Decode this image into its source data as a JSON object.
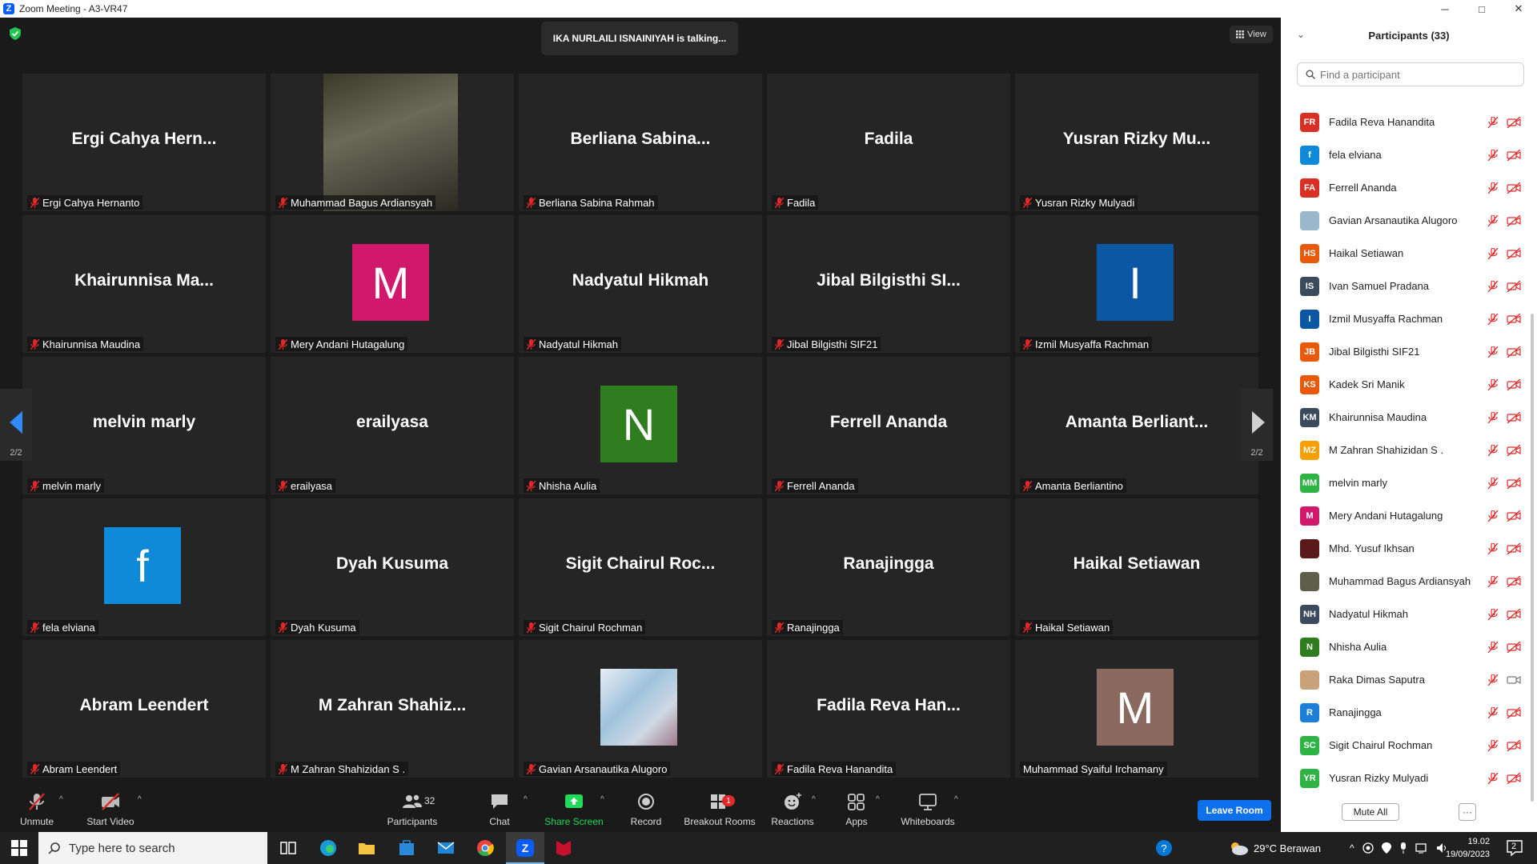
{
  "window": {
    "title": "Zoom Meeting - A3-VR47",
    "minimize": "─",
    "maximize": "□",
    "close": "✕"
  },
  "meeting": {
    "talking_indicator": "IKA NURLAILI ISNAINIYAH is talking...",
    "view_button": "View",
    "page_indicator_left": "2/2",
    "page_indicator_right": "2/2",
    "tiles": [
      {
        "display": "Ergi Cahya Hern...",
        "label": "Ergi Cahya Hernanto",
        "kind": "name",
        "muted": true
      },
      {
        "display": "",
        "label": "Muhammad Bagus Ardiansyah",
        "kind": "photo",
        "muted": true
      },
      {
        "display": "Berliana  Sabina...",
        "label": "Berliana Sabina Rahmah",
        "kind": "name",
        "muted": true
      },
      {
        "display": "Fadila",
        "label": "Fadila",
        "kind": "name",
        "muted": true
      },
      {
        "display": "Yusran  Rizky  Mu...",
        "label": "Yusran Rizky Mulyadi",
        "kind": "name",
        "muted": true
      },
      {
        "display": "Khairunnisa  Ma...",
        "label": "Khairunnisa Maudina",
        "kind": "name",
        "muted": true
      },
      {
        "display": "M",
        "label": "Mery Andani Hutagalung",
        "kind": "avatar",
        "color": "#d0196b",
        "muted": true
      },
      {
        "display": "Nadyatul Hikmah",
        "label": "Nadyatul Hikmah",
        "kind": "name",
        "muted": true
      },
      {
        "display": "Jibal  Bilgisthi  SI...",
        "label": "Jibal Bilgisthi SIF21",
        "kind": "name",
        "muted": true
      },
      {
        "display": "I",
        "label": "Izmil Musyaffa Rachman",
        "kind": "avatar",
        "color": "#0b57a4",
        "muted": true
      },
      {
        "display": "melvin marly",
        "label": "melvin marly",
        "kind": "name",
        "muted": true
      },
      {
        "display": "erailyasa",
        "label": "erailyasa",
        "kind": "name",
        "muted": true
      },
      {
        "display": "N",
        "label": "Nhisha Aulia",
        "kind": "avatar",
        "color": "#2e7d1e",
        "muted": true
      },
      {
        "display": "Ferrell Ananda",
        "label": "Ferrell Ananda",
        "kind": "name",
        "muted": true
      },
      {
        "display": "Amanta  Berliant...",
        "label": "Amanta Berliantino",
        "kind": "name",
        "muted": true
      },
      {
        "display": "f",
        "label": "fela elviana",
        "kind": "avatar",
        "color": "#0e8ad8",
        "muted": true
      },
      {
        "display": "Dyah Kusuma",
        "label": "Dyah Kusuma",
        "kind": "name",
        "muted": true
      },
      {
        "display": "Sigit  Chairul  Roc...",
        "label": "Sigit Chairul Rochman",
        "kind": "name",
        "muted": true
      },
      {
        "display": "Ranajingga",
        "label": "Ranajingga",
        "kind": "name",
        "muted": true
      },
      {
        "display": "Haikal Setiawan",
        "label": "Haikal Setiawan",
        "kind": "name",
        "muted": true
      },
      {
        "display": "Abram Leendert",
        "label": "Abram Leendert",
        "kind": "name",
        "muted": true
      },
      {
        "display": "M  Zahran  Shahiz...",
        "label": "M Zahran Shahizidan S .",
        "kind": "name",
        "muted": true
      },
      {
        "display": "",
        "label": "Gavian Arsanautika Alugoro",
        "kind": "photo2",
        "muted": true
      },
      {
        "display": "Fadila  Reva  Han...",
        "label": "Fadila Reva Hanandita",
        "kind": "name",
        "muted": true
      },
      {
        "display": "M",
        "label": "Muhammad Syaiful Irchamany",
        "kind": "avatar",
        "color": "#8a6a5e",
        "muted": false
      }
    ]
  },
  "toolbar": {
    "unmute": "Unmute",
    "start_video": "Start Video",
    "participants": "Participants",
    "participants_count": "32",
    "chat": "Chat",
    "share_screen": "Share Screen",
    "record": "Record",
    "breakout_rooms": "Breakout Rooms",
    "breakout_badge": "1",
    "reactions": "Reactions",
    "apps": "Apps",
    "whiteboards": "Whiteboards",
    "leave": "Leave Room"
  },
  "panel": {
    "title": "Participants (33)",
    "search_placeholder": "Find a participant",
    "mute_all": "Mute All",
    "more": "···",
    "participants": [
      {
        "initials": "FR",
        "name": "Fadila Reva Hanandita",
        "color": "#d93025",
        "video": "off"
      },
      {
        "initials": "f",
        "name": "fela elviana",
        "color": "#0e8ad8",
        "video": "off"
      },
      {
        "initials": "FA",
        "name": "Ferrell Ananda",
        "color": "#d93025",
        "video": "off"
      },
      {
        "initials": "",
        "name": "Gavian Arsanautika Alugoro",
        "color": "#9bb7cc",
        "video": "off"
      },
      {
        "initials": "HS",
        "name": "Haikal Setiawan",
        "color": "#e8590c",
        "video": "off"
      },
      {
        "initials": "IS",
        "name": "Ivan Samuel Pradana",
        "color": "#3c4a5e",
        "video": "off"
      },
      {
        "initials": "I",
        "name": "Izmil Musyaffa Rachman",
        "color": "#0b57a4",
        "video": "off"
      },
      {
        "initials": "JB",
        "name": "Jibal Bilgisthi SIF21",
        "color": "#e8590c",
        "video": "off"
      },
      {
        "initials": "KS",
        "name": "Kadek Sri Manik",
        "color": "#e8590c",
        "video": "off"
      },
      {
        "initials": "KM",
        "name": "Khairunnisa Maudina",
        "color": "#3c4a5e",
        "video": "off"
      },
      {
        "initials": "MZ",
        "name": "M Zahran Shahizidan S .",
        "color": "#f59f00",
        "video": "off"
      },
      {
        "initials": "MM",
        "name": "melvin marly",
        "color": "#2fb344",
        "video": "off"
      },
      {
        "initials": "M",
        "name": "Mery Andani Hutagalung",
        "color": "#d0196b",
        "video": "off"
      },
      {
        "initials": "",
        "name": "Mhd. Yusuf Ikhsan",
        "color": "#5a1a1a",
        "video": "off"
      },
      {
        "initials": "",
        "name": "Muhammad Bagus Ardiansyah",
        "color": "#5e5e4a",
        "video": "off"
      },
      {
        "initials": "NH",
        "name": "Nadyatul Hikmah",
        "color": "#3c4a5e",
        "video": "off"
      },
      {
        "initials": "N",
        "name": "Nhisha Aulia",
        "color": "#2e7d1e",
        "video": "off"
      },
      {
        "initials": "",
        "name": "Raka Dimas Saputra",
        "color": "#c9a27a",
        "video": "on"
      },
      {
        "initials": "R",
        "name": "Ranajingga",
        "color": "#1c7ed6",
        "video": "off"
      },
      {
        "initials": "SC",
        "name": "Sigit Chairul Rochman",
        "color": "#2fb344",
        "video": "off"
      },
      {
        "initials": "YR",
        "name": "Yusran Rizky Mulyadi",
        "color": "#2fb344",
        "video": "off"
      }
    ]
  },
  "taskbar": {
    "search_placeholder": "Type here to search",
    "weather": "29°C  Berawan",
    "time": "19.02",
    "date": "19/09/2023",
    "notifications": "2"
  },
  "colors": {
    "accent": "#0e71eb",
    "share_green": "#23d959",
    "muted_red": "#e02828",
    "talking_bg": "#2b2b2b"
  }
}
